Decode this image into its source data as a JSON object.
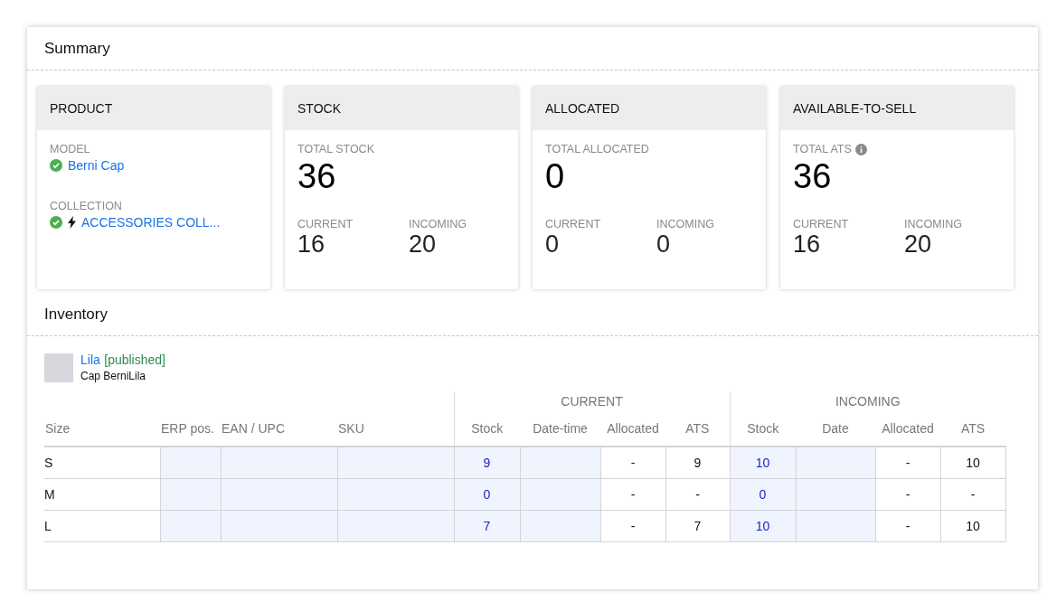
{
  "summary": {
    "title": "Summary",
    "cards": [
      {
        "kind": "product",
        "title": "PRODUCT",
        "model_label": "MODEL",
        "model": "Berni Cap",
        "collection_label": "COLLECTION",
        "collection": "ACCESSORIES COLL..."
      },
      {
        "kind": "metric",
        "title": "STOCK",
        "total_label": "TOTAL STOCK",
        "info": false,
        "total": "36",
        "current_label": "CURRENT",
        "current": "16",
        "incoming_label": "INCOMING",
        "incoming": "20"
      },
      {
        "kind": "metric",
        "title": "ALLOCATED",
        "total_label": "TOTAL ALLOCATED",
        "info": false,
        "total": "0",
        "current_label": "CURRENT",
        "current": "0",
        "incoming_label": "INCOMING",
        "incoming": "0"
      },
      {
        "kind": "metric",
        "title": "AVAILABLE-TO-SELL",
        "total_label": "TOTAL ATS",
        "info": true,
        "total": "36",
        "current_label": "CURRENT",
        "current": "16",
        "incoming_label": "INCOMING",
        "incoming": "20"
      }
    ]
  },
  "inventory": {
    "title": "Inventory",
    "variant": {
      "name": "Lila",
      "status": "[published]",
      "subtitle": "Cap BerniLila"
    },
    "groups": [
      "CURRENT",
      "INCOMING"
    ],
    "columns": [
      "Size",
      "ERP pos.",
      "EAN / UPC",
      "SKU",
      "Stock",
      "Date-time",
      "Allocated",
      "ATS",
      "Stock",
      "Date",
      "Allocated",
      "ATS"
    ],
    "rows": [
      {
        "size": "S",
        "current_stock": "9",
        "current_allocated": "-",
        "current_ats": "9",
        "incoming_stock": "10",
        "incoming_allocated": "-",
        "incoming_ats": "10"
      },
      {
        "size": "M",
        "current_stock": "0",
        "current_allocated": "-",
        "current_ats": "-",
        "incoming_stock": "0",
        "incoming_allocated": "-",
        "incoming_ats": "-"
      },
      {
        "size": "L",
        "current_stock": "7",
        "current_allocated": "-",
        "current_ats": "7",
        "incoming_stock": "10",
        "incoming_allocated": "-",
        "incoming_ats": "10"
      }
    ]
  }
}
